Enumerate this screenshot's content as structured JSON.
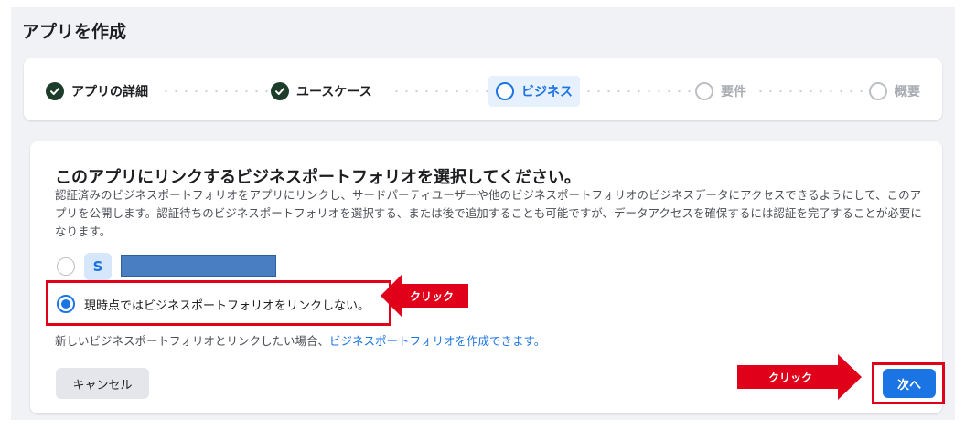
{
  "page": {
    "title": "アプリを作成"
  },
  "stepper": {
    "steps": [
      {
        "label": "アプリの詳細",
        "state": "done"
      },
      {
        "label": "ユースケース",
        "state": "done"
      },
      {
        "label": "ビジネス",
        "state": "active"
      },
      {
        "label": "要件",
        "state": "todo"
      },
      {
        "label": "概要",
        "state": "todo"
      }
    ]
  },
  "card": {
    "title": "このアプリにリンクするビジネスポートフォリオを選択してください。",
    "description": "認証済みのビジネスポートフォリオをアプリにリンクし、サードパーティユーザーや他のビジネスポートフォリオのビジネスデータにアクセスできるようにして、このアプリを公開します。認証待ちのビジネスポートフォリオを選択する、または後で追加することも可能ですが、データアクセスを確保するには認証を完了することが必要になります。",
    "options": [
      {
        "avatar_letter": "S",
        "selected": false
      },
      {
        "label": "現時点ではビジネスポートフォリオをリンクしない。",
        "selected": true
      }
    ],
    "note_prefix": "新しいビジネスポートフォリオとリンクしたい場合、",
    "note_link": "ビジネスポートフォリオを作成できます。"
  },
  "buttons": {
    "cancel": "キャンセル",
    "next": "次へ"
  },
  "annotations": {
    "click_label_1": "クリック",
    "click_label_2": "クリック"
  },
  "colors": {
    "accent": "#1b74e4",
    "highlight": "#e0001a",
    "done_check": "#1c3d2a"
  }
}
